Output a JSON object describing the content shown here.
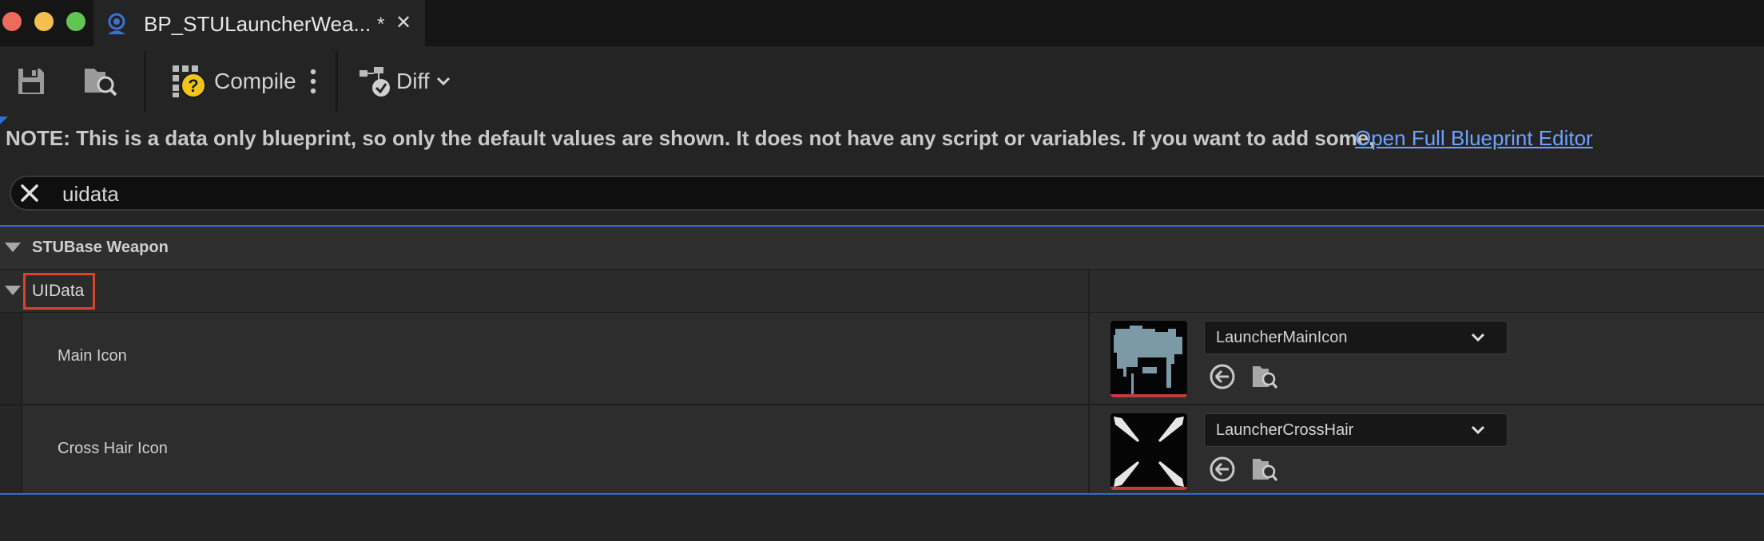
{
  "window": {
    "tab_title": "BP_STULauncherWea...",
    "tab_dirty_marker": "*",
    "tab_close_glyph": "✕",
    "tab_icon": "blueprint-icon"
  },
  "toolbar": {
    "save_icon": "save-icon",
    "browse_icon": "browse-asset-icon",
    "compile_label": "Compile",
    "compile_status_icon": "compile-unknown-icon",
    "more_icon": "vertical-ellipsis-icon",
    "diff_label": "Diff",
    "diff_icon": "diff-icon"
  },
  "note": {
    "text": "NOTE: This is a data only blueprint, so only the default values are shown.  It does not have any script or variables.  If you want to add some,",
    "link": "Open Full Blueprint Editor"
  },
  "search": {
    "value": "uidata",
    "placeholder": ""
  },
  "details": {
    "category": "STUBase Weapon",
    "subcategory": "UIData",
    "properties": [
      {
        "label": "Main Icon",
        "asset": "LauncherMainIcon"
      },
      {
        "label": "Cross Hair Icon",
        "asset": "LauncherCrossHair"
      }
    ]
  },
  "colors": {
    "accent_blue": "#2f6cd6",
    "link_blue": "#6da2ff",
    "highlight_red": "#d8452b",
    "thumb_bar_red": "#c13c3c"
  }
}
